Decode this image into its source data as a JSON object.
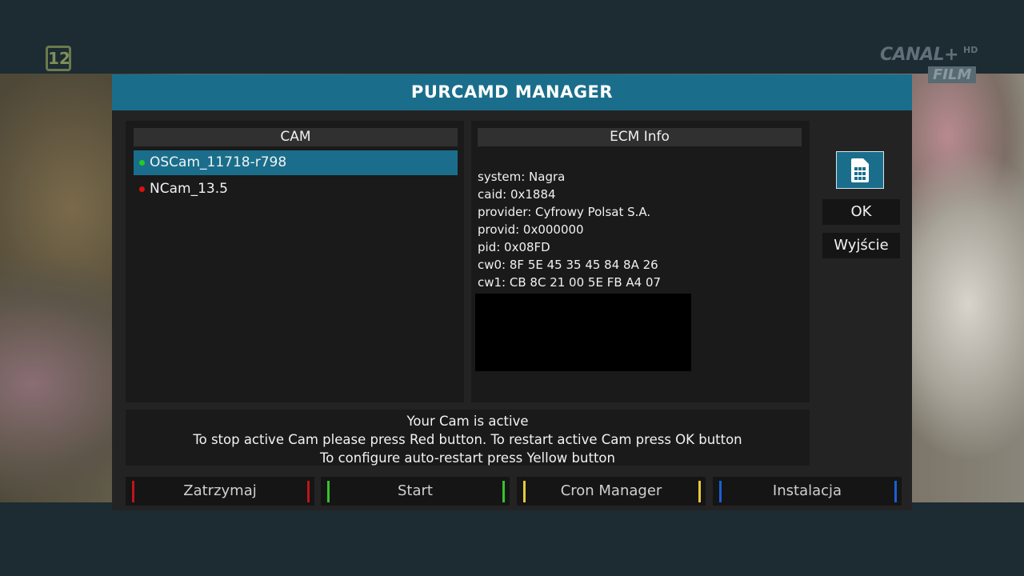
{
  "background": {
    "channel_number": "12",
    "channel_logo_line1": "CANAL+",
    "channel_logo_hd": "HD",
    "channel_logo_line2": "FILM"
  },
  "dialog": {
    "title": "PURCAMD MANAGER"
  },
  "cam_panel": {
    "header": "CAM",
    "items": [
      {
        "label": "OSCam_11718-r798",
        "status_color": "#22cc22",
        "selected": true
      },
      {
        "label": "NCam_13.5",
        "status_color": "#dd1111",
        "selected": false
      }
    ]
  },
  "ecm_panel": {
    "header": "ECM Info",
    "lines": [
      "system: Nagra",
      "caid: 0x1884",
      "provider: Cyfrowy Polsat S.A.",
      "provid: 0x000000",
      "pid: 0x08FD",
      "cw0: 8F 5E 45 35 45 84 8A 26",
      "cw1: CB 8C 21 00 5E FB A4 07"
    ]
  },
  "side_buttons": {
    "sim_icon": "sim-card-icon",
    "ok_label": "OK",
    "exit_label": "Wyjście"
  },
  "info": {
    "line1": "Your Cam is active",
    "line2": "To stop active Cam please press Red button. To restart active Cam press OK button",
    "line3": "To configure auto-restart press Yellow button"
  },
  "footer": {
    "buttons": [
      {
        "label": "Zatrzymaj",
        "color": "#c0141a"
      },
      {
        "label": "Start",
        "color": "#35c428"
      },
      {
        "label": "Cron Manager",
        "color": "#e8c83a"
      },
      {
        "label": "Instalacja",
        "color": "#1a5fd4"
      }
    ]
  },
  "colors": {
    "accent": "#1a6e8c",
    "dialog_bg": "#232323",
    "panel_bg": "#1a1a1a"
  }
}
